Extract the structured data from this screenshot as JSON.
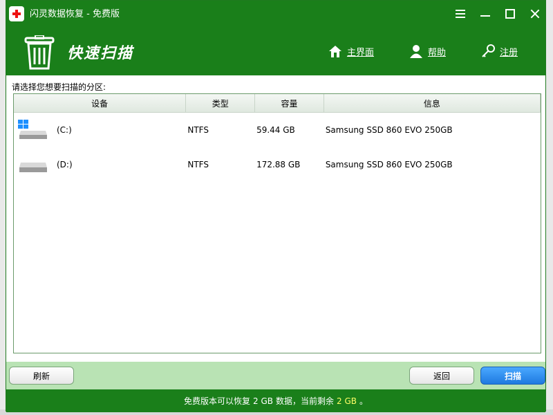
{
  "app": {
    "title": "闪灵数据恢复 - 免费版",
    "colors": {
      "primary": "#1a7f1a",
      "footer_bar": "#b9e3b4",
      "scan_button": "#1e7ae0",
      "highlight": "#ffff66"
    }
  },
  "header": {
    "title": "快速扫描",
    "nav": [
      {
        "label": "主界面",
        "icon": "home-icon"
      },
      {
        "label": "帮助",
        "icon": "help-person-icon"
      },
      {
        "label": "注册",
        "icon": "key-icon"
      }
    ]
  },
  "prompt": "请选择您想要扫描的分区:",
  "table": {
    "columns": [
      "设备",
      "类型",
      "容量",
      "信息"
    ],
    "rows": [
      {
        "device": "(C:)",
        "type": "NTFS",
        "capacity": "59.44 GB",
        "info": "Samsung SSD 860 EVO 250GB",
        "icon": "windows-drive-icon"
      },
      {
        "device": "(D:)",
        "type": "NTFS",
        "capacity": "172.88 GB",
        "info": "Samsung SSD 860 EVO 250GB",
        "icon": "drive-icon"
      }
    ]
  },
  "buttons": {
    "refresh": "刷新",
    "back": "返回",
    "scan": "扫描"
  },
  "status": {
    "prefix": "免费版本可以恢复",
    "limit": "2 GB",
    "middle": "数据，当前剩余",
    "remaining": "2 GB",
    "suffix": "。"
  }
}
